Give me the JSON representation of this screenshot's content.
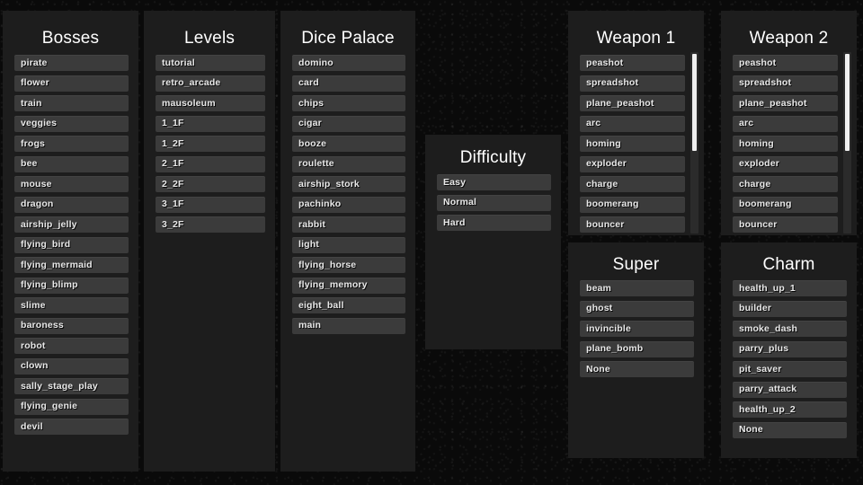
{
  "background_color": "#0a0a0a",
  "panel_color": "#1d1d1d",
  "item_color": "#3b3b3b",
  "title_color": "#ffffff",
  "item_text_color": "#e9e9e9",
  "panels": {
    "bosses": {
      "title": "Bosses",
      "items": [
        "pirate",
        "flower",
        "train",
        "veggies",
        "frogs",
        "bee",
        "mouse",
        "dragon",
        "airship_jelly",
        "flying_bird",
        "flying_mermaid",
        "flying_blimp",
        "slime",
        "baroness",
        "robot",
        "clown",
        "sally_stage_play",
        "flying_genie",
        "devil"
      ]
    },
    "levels": {
      "title": "Levels",
      "items": [
        "tutorial",
        "retro_arcade",
        "mausoleum",
        "1_1F",
        "1_2F",
        "2_1F",
        "2_2F",
        "3_1F",
        "3_2F"
      ]
    },
    "dice_palace": {
      "title": "Dice Palace",
      "items": [
        "domino",
        "card",
        "chips",
        "cigar",
        "booze",
        "roulette",
        "airship_stork",
        "pachinko",
        "rabbit",
        "light",
        "flying_horse",
        "flying_memory",
        "eight_ball",
        "main"
      ]
    },
    "difficulty": {
      "title": "Difficulty",
      "items": [
        "Easy",
        "Normal",
        "Hard"
      ]
    },
    "weapon1": {
      "title": "Weapon 1",
      "items": [
        "peashot",
        "spreadshot",
        "plane_peashot",
        "arc",
        "homing",
        "exploder",
        "charge",
        "boomerang",
        "bouncer"
      ],
      "scrollbar": {
        "thumb_position": "top",
        "thumb_fraction": 0.53
      }
    },
    "weapon2": {
      "title": "Weapon 2",
      "items": [
        "peashot",
        "spreadshot",
        "plane_peashot",
        "arc",
        "homing",
        "exploder",
        "charge",
        "boomerang",
        "bouncer"
      ],
      "scrollbar": {
        "thumb_position": "top",
        "thumb_fraction": 0.53
      }
    },
    "super": {
      "title": "Super",
      "items": [
        "beam",
        "ghost",
        "invincible",
        "plane_bomb",
        "None"
      ]
    },
    "charm": {
      "title": "Charm",
      "items": [
        "health_up_1",
        "builder",
        "smoke_dash",
        "parry_plus",
        "pit_saver",
        "parry_attack",
        "health_up_2",
        "None"
      ]
    }
  }
}
